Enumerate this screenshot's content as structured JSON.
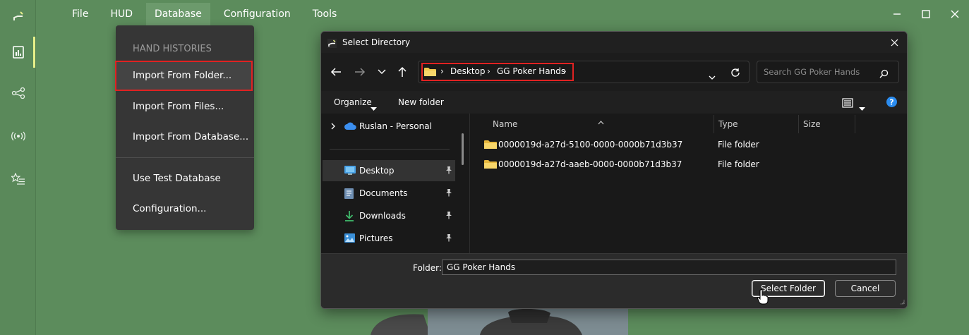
{
  "app": {
    "menu": [
      "File",
      "HUD",
      "Database",
      "Configuration",
      "Tools"
    ],
    "active_menu": "Database",
    "rail_icons": [
      "logo-icon",
      "report-icon",
      "share-nodes-icon",
      "broadcast-icon",
      "starred-list-icon"
    ],
    "window_controls": [
      "minimize-icon",
      "maximize-icon",
      "close-icon"
    ]
  },
  "dropdown": {
    "header": "HAND HISTORIES",
    "items": [
      "Import From Folder...",
      "Import From Files...",
      "Import From Database...",
      "Use Test Database",
      "Configuration..."
    ],
    "highlighted": "Import From Folder..."
  },
  "dialog": {
    "title": "Select Directory",
    "breadcrumb": [
      "Desktop",
      "GG Poker Hands"
    ],
    "search_placeholder": "Search GG Poker Hands",
    "toolbar": {
      "organize": "Organize",
      "new_folder": "New folder"
    },
    "nav_pane": {
      "account": "Ruslan - Personal",
      "items": [
        {
          "label": "Desktop",
          "icon": "desktop-icon",
          "selected": true
        },
        {
          "label": "Documents",
          "icon": "documents-icon",
          "selected": false
        },
        {
          "label": "Downloads",
          "icon": "download-icon",
          "selected": false
        },
        {
          "label": "Pictures",
          "icon": "pictures-icon",
          "selected": false
        }
      ]
    },
    "columns": [
      "Name",
      "Type",
      "Size"
    ],
    "files": [
      {
        "name": "0000019d-a27d-5100-0000-0000b71d3b37",
        "type": "File folder"
      },
      {
        "name": "0000019d-a27d-aaeb-0000-0000b71d3b37",
        "type": "File folder"
      }
    ],
    "folder_label": "Folder:",
    "folder_value": "GG Poker Hands",
    "select_button": "Select Folder",
    "cancel_button": "Cancel"
  },
  "colors": {
    "background": "#5c8c5c",
    "highlight_border": "#e02222",
    "folder_yellow": "#f2c94c",
    "active_bar": "#e7f08a",
    "help_blue": "#2b8cef"
  }
}
